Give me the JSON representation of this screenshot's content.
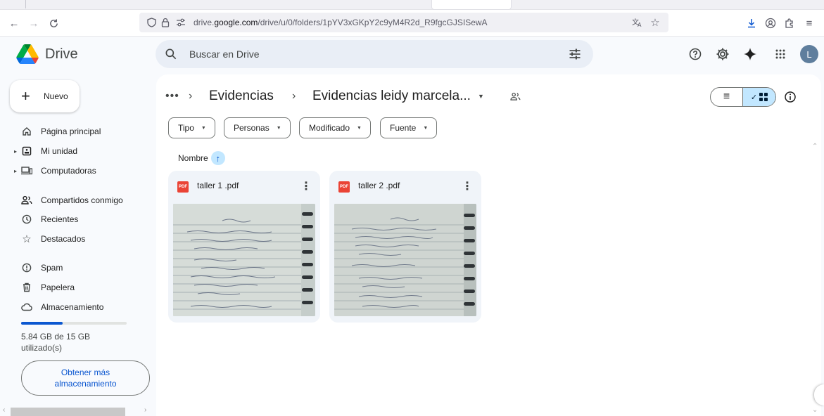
{
  "browser": {
    "url_prefix": "drive.",
    "url_domain": "google.com",
    "url_path": "/drive/u/0/folders/1pYV3xGKpY2c9yM4R2d_R9fgcGJSISewA"
  },
  "header": {
    "app_name": "Drive",
    "search_placeholder": "Buscar en Drive",
    "avatar_letter": "L"
  },
  "sidebar": {
    "new_label": "Nuevo",
    "items": [
      {
        "label": "Página principal",
        "icon": "home-icon"
      },
      {
        "label": "Mi unidad",
        "icon": "my-drive-icon"
      },
      {
        "label": "Computadoras",
        "icon": "computers-icon"
      },
      {
        "label": "Compartidos conmigo",
        "icon": "people-icon"
      },
      {
        "label": "Recientes",
        "icon": "clock-icon"
      },
      {
        "label": "Destacados",
        "icon": "star-icon"
      },
      {
        "label": "Spam",
        "icon": "spam-icon"
      },
      {
        "label": "Papelera",
        "icon": "trash-icon"
      },
      {
        "label": "Almacenamiento",
        "icon": "cloud-icon"
      }
    ],
    "storage_used_fraction": 0.39,
    "storage_text": "5.84 GB de 15 GB utilizado(s)",
    "get_more_label": "Obtener más almacenamiento"
  },
  "main": {
    "breadcrumb_parent": "Evidencias",
    "breadcrumb_current": "Evidencias leidy marcela...",
    "filters": [
      "Tipo",
      "Personas",
      "Modificado",
      "Fuente"
    ],
    "sort_label": "Nombre",
    "files": [
      {
        "name": "taller 1 .pdf",
        "badge": "PDF"
      },
      {
        "name": "taller 2 .pdf",
        "badge": "PDF"
      }
    ]
  },
  "colors": {
    "accent": "#0b57d0",
    "selected_bg": "#c2e7ff",
    "pdf_red": "#ea4335"
  }
}
